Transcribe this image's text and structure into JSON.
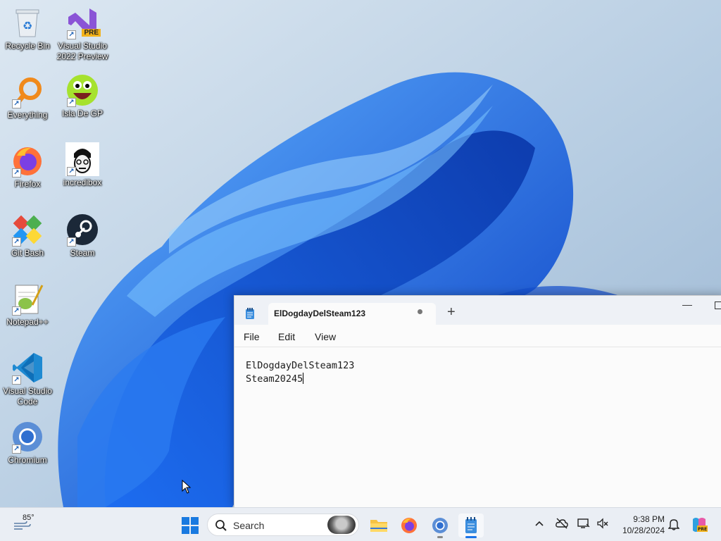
{
  "desktop": {
    "icons": [
      {
        "label": "Recycle Bin"
      },
      {
        "label": "Visual Studio 2022 Preview",
        "badge": "PRE"
      },
      {
        "label": "Everything"
      },
      {
        "label": "Isla De GP"
      },
      {
        "label": "Firefox"
      },
      {
        "label": "incredibox"
      },
      {
        "label": "Git Bash"
      },
      {
        "label": "Steam"
      },
      {
        "label": "Notepad++"
      },
      {
        "label": "Visual Studio Code"
      },
      {
        "label": "Chromium"
      }
    ]
  },
  "notepad": {
    "tab_title": "ElDogdayDelSteam123",
    "new_tab_symbol": "+",
    "menu": [
      "File",
      "Edit",
      "View"
    ],
    "content_line1": "ElDogdayDelSteam123",
    "content_line2": "Steam20245"
  },
  "taskbar": {
    "weather_temp": "85°",
    "search_placeholder": "Search",
    "apps": [
      "file-explorer",
      "firefox",
      "chromium",
      "notepad"
    ],
    "active_app": "notepad",
    "clock_time": "9:38 PM",
    "clock_date": "10/28/2024",
    "accent": "#1a73e8"
  }
}
